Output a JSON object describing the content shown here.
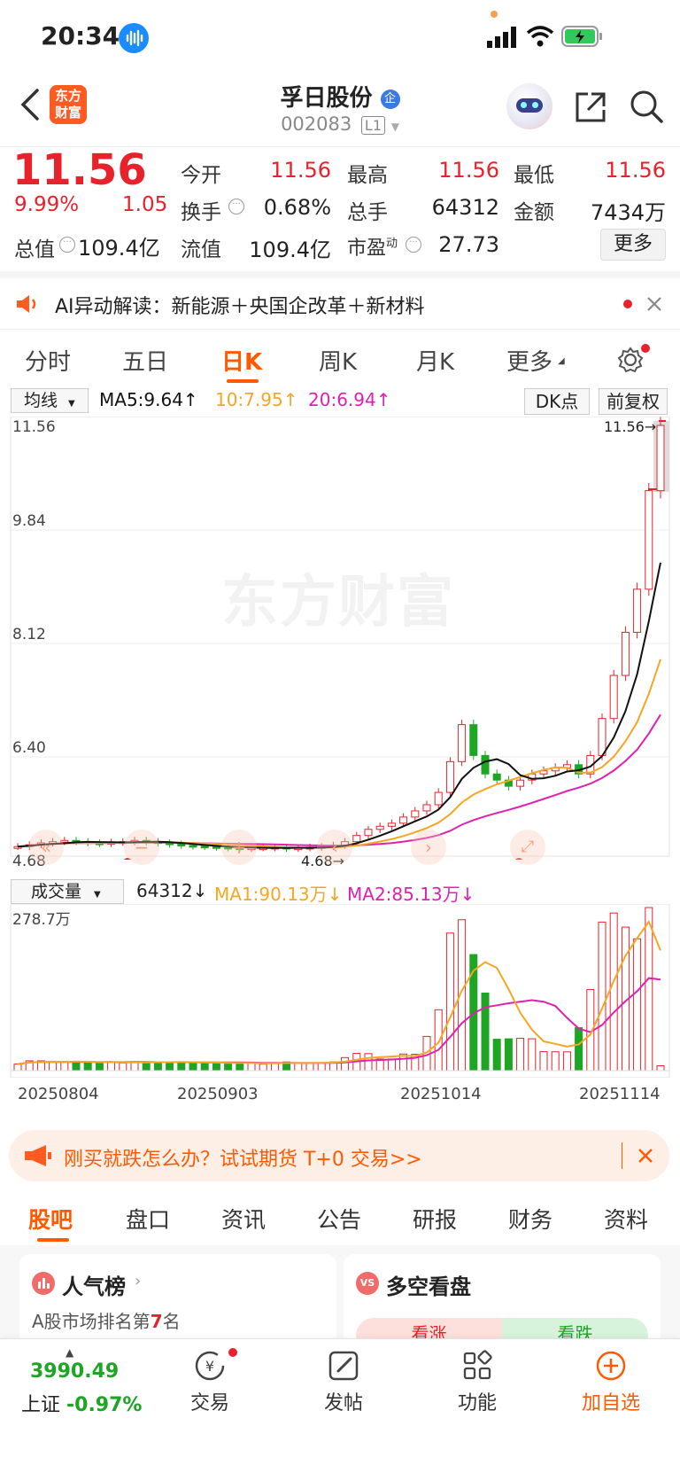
{
  "status_bar": {
    "time": "20:34"
  },
  "header": {
    "logo_line1": "东方",
    "logo_line2": "财富",
    "stock_name": "孚日股份",
    "badge": "企",
    "code": "002083",
    "level": "L1"
  },
  "quote": {
    "price": "11.56",
    "change_pct": "9.99%",
    "change": "1.05",
    "fields": [
      {
        "label": "今开",
        "value": "11.56"
      },
      {
        "label": "最高",
        "value": "11.56"
      },
      {
        "label": "最低",
        "value": "11.56"
      },
      {
        "label": "换手",
        "value": "0.68%"
      },
      {
        "label": "总手",
        "value": "64312"
      },
      {
        "label": "金额",
        "value": "7434万"
      },
      {
        "label": "总值",
        "value": "109.4亿"
      },
      {
        "label": "流值",
        "value": "109.4亿"
      },
      {
        "label": "市盈",
        "sup": "动",
        "value": "27.73"
      }
    ],
    "more_button": "更多"
  },
  "ai_banner": {
    "prefix": "AI异动解读：",
    "text": "新能源＋央国企改革＋新材料"
  },
  "chart_tabs": [
    "分时",
    "五日",
    "日K",
    "周K",
    "月K",
    "更多"
  ],
  "active_tab": "日K",
  "indicator_bar": {
    "select": "均线",
    "ma5": "MA5:9.64↑",
    "ma10": "10:7.95↑",
    "ma20": "20:6.94↑",
    "dk_button": "DK点",
    "adjust_button": "前复权"
  },
  "colors": {
    "up": "#e8222b",
    "down": "#1ea524",
    "ma5": "#111111",
    "ma10": "#f5a623",
    "ma20": "#e020b0",
    "accent": "#ff5a00"
  },
  "price_axis": [
    "11.56",
    "9.84",
    "8.12",
    "6.40",
    "4.68"
  ],
  "price_labels": {
    "high_marker": "11.56→",
    "low_marker": "4.68→"
  },
  "watermark": "东方财富",
  "volume_bar": {
    "select": "成交量",
    "vol": "64312↓",
    "ma1": "MA1:90.13万↓",
    "ma2": "MA2:85.13万↓",
    "max_label": "278.7万"
  },
  "date_axis": [
    "20250804",
    "20250903",
    "20251014",
    "20251114"
  ],
  "chart_data": {
    "type": "bar",
    "title": "",
    "ylim": [
      4.68,
      11.56
    ],
    "candles_close": [
      4.72,
      4.75,
      4.78,
      4.8,
      4.82,
      4.8,
      4.78,
      4.77,
      4.79,
      4.8,
      4.82,
      4.8,
      4.78,
      4.76,
      4.74,
      4.73,
      4.72,
      4.71,
      4.7,
      4.69,
      4.7,
      4.7,
      4.71,
      4.69,
      4.7,
      4.71,
      4.72,
      4.74,
      4.8,
      4.9,
      5.0,
      5.05,
      5.1,
      5.2,
      5.3,
      5.4,
      5.6,
      6.1,
      6.7,
      6.2,
      5.9,
      5.8,
      5.7,
      5.8,
      5.9,
      5.95,
      6.0,
      6.05,
      5.9,
      6.2,
      6.8,
      7.5,
      8.2,
      8.9,
      10.5,
      11.56
    ],
    "volume_max": "278.7万"
  },
  "ad_banner": {
    "text": "刚买就跌怎么办？试试期货 T+0 交易>>"
  },
  "sub_tabs": [
    "股吧",
    "盘口",
    "资讯",
    "公告",
    "研报",
    "财务",
    "资料"
  ],
  "cards": {
    "popularity_title": "人气榜",
    "rank_text": "A股市场排名第",
    "rank_num": "7",
    "rank_suffix": "名",
    "bull_bear_title": "多空看盘",
    "bull": "看涨",
    "bear": "看跌"
  },
  "bottom_bar": {
    "index_value": "3990.49",
    "index_name": "上证",
    "index_change": "-0.97%",
    "trade": "交易",
    "post": "发帖",
    "function": "功能",
    "add_watch": "加自选"
  }
}
